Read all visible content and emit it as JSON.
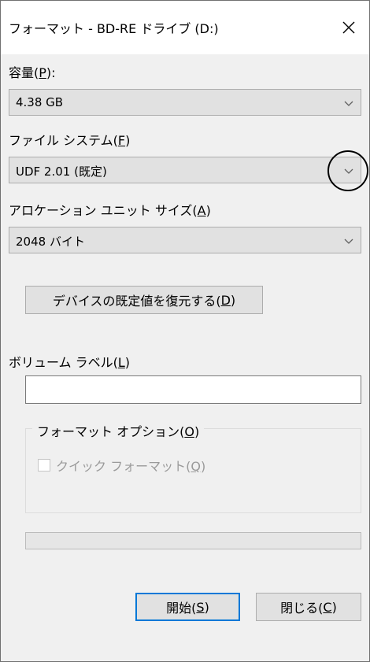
{
  "window": {
    "title": "フォーマット - BD-RE ドライブ (D:)",
    "close_icon": "close-icon"
  },
  "capacity": {
    "label_main": "容量(",
    "label_key": "P",
    "label_tail": "):",
    "value": "4.38 GB"
  },
  "filesystem": {
    "label_main": "ファイル システム(",
    "label_key": "F",
    "label_tail": ")",
    "value": "UDF 2.01 (既定)"
  },
  "allocation": {
    "label_main": "アロケーション ユニット サイズ(",
    "label_key": "A",
    "label_tail": ")",
    "value": "2048 バイト"
  },
  "restore_button": {
    "main": "デバイスの既定値を復元する(",
    "key": "D",
    "tail": ")"
  },
  "volume": {
    "label_main": "ボリューム ラベル(",
    "label_key": "L",
    "label_tail": ")",
    "value": ""
  },
  "format_options": {
    "group_main": "フォーマット オプション(",
    "group_key": "O",
    "group_tail": ")",
    "quick_main": "クイック フォーマット(",
    "quick_key": "Q",
    "quick_tail": ")",
    "quick_checked": false
  },
  "progress": {
    "fraction": 0
  },
  "buttons": {
    "start_main": "開始(",
    "start_key": "S",
    "start_tail": ")",
    "close_main": "閉じる(",
    "close_key": "C",
    "close_tail": ")"
  },
  "colors": {
    "accent": "#0078d7",
    "progress": "#06b025"
  }
}
